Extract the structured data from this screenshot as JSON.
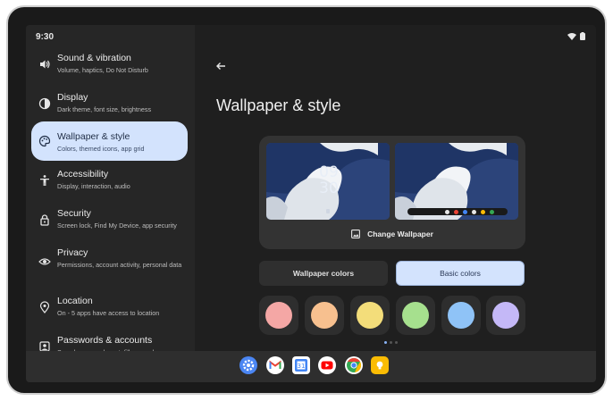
{
  "status": {
    "time": "9:30",
    "icons": [
      "wifi-icon",
      "battery-icon"
    ]
  },
  "sidebar": {
    "items": [
      {
        "icon": "volume-icon",
        "title": "Sound & vibration",
        "subtitle": "Volume, haptics, Do Not Disturb",
        "active": false
      },
      {
        "icon": "display-icon",
        "title": "Display",
        "subtitle": "Dark theme, font size, brightness",
        "active": false
      },
      {
        "icon": "palette-icon",
        "title": "Wallpaper & style",
        "subtitle": "Colors, themed icons, app grid",
        "active": true
      },
      {
        "icon": "accessibility-icon",
        "title": "Accessibility",
        "subtitle": "Display, interaction, audio",
        "active": false
      },
      {
        "icon": "lock-icon",
        "title": "Security",
        "subtitle": "Screen lock, Find My Device, app security",
        "active": false
      },
      {
        "icon": "privacy-icon",
        "title": "Privacy",
        "subtitle": "Permissions, account activity, personal data",
        "active": false
      },
      {
        "icon": "location-icon",
        "title": "Location",
        "subtitle": "On - 5 apps have access to location",
        "active": false
      },
      {
        "icon": "accounts-icon",
        "title": "Passwords & accounts",
        "subtitle": "Saved passwords, autofill, synced",
        "active": false
      }
    ]
  },
  "main": {
    "title": "Wallpaper & style",
    "lock_clock_hour": "09",
    "lock_clock_minute": "30",
    "change_wallpaper_label": "Change Wallpaper",
    "tabs": [
      {
        "label": "Wallpaper colors",
        "selected": false
      },
      {
        "label": "Basic colors",
        "selected": true
      }
    ],
    "swatches": [
      "#f4a7a5",
      "#f7c08f",
      "#f3dd7a",
      "#a6e08e",
      "#8fc3f7",
      "#c4b8f7"
    ],
    "accent": "#d3e3fd"
  },
  "taskbar": {
    "apps": [
      "settings-app-icon",
      "gmail-app-icon",
      "calendar-app-icon",
      "youtube-app-icon",
      "chrome-app-icon",
      "keep-app-icon"
    ]
  }
}
